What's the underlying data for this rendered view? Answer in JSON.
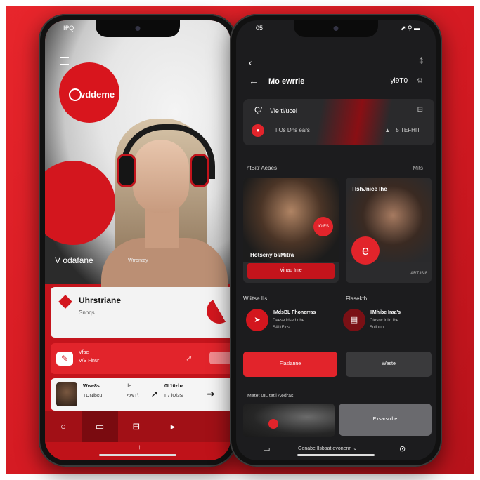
{
  "left_phone": {
    "status": {
      "time": "I₽Q"
    },
    "hero": {
      "brand": "vddeme",
      "caption": "V odafane",
      "sub": "Wrronæy"
    },
    "card": {
      "title": "Uhrstriane",
      "subtitle": "Snnqs"
    },
    "promo": {
      "line1": "Vfae",
      "line2": "V/S Flnur",
      "badge": ""
    },
    "list": {
      "a1": "Wwe8s",
      "a2": "TDNlbsu",
      "b1": "lle",
      "b2": "AWT\\",
      "c1": "0I 10zba",
      "c2": "I 7 lUl3S"
    },
    "tabs": [
      "○",
      "▭",
      "⊟",
      "▸"
    ],
    "bottom": "↑"
  },
  "right_phone": {
    "status": {
      "time": "05",
      "icons": "⬈ ⚲ ▬"
    },
    "top_back": "‹",
    "top_icon": "⁑",
    "header": {
      "title": "Mo ewrrie",
      "count": "yl9T0",
      "settings": "⚙"
    },
    "player": {
      "q": "Ç/",
      "title": "Vie tl/ucel",
      "right": "⊟",
      "line2": "I!Os Dhs ears",
      "line3": "▲  ⠀5 ṮEFHIT"
    },
    "section1": {
      "left": "ThtBitr Aeaes",
      "right": "Mits"
    },
    "tile_a": {
      "label": "Hotseny bI/Mitra",
      "button": "Vinau Ime",
      "pill": "IOIFS"
    },
    "tile_b": {
      "head": "TlshJnice Ihe",
      "logo": "e",
      "tiny": "ARTJSI8"
    },
    "section2": {
      "left": "Wiiitse IIs",
      "right": "Flasekth"
    },
    "ep_a": {
      "t1": "IMdsBL Fhonerras",
      "t2": "Deese ldsed dbe",
      "t3": "SAIltFIcs"
    },
    "ep_b": {
      "t1": "IIMhibe Iraa's",
      "t2": "Ctesnc ir iln lbe",
      "t3": "Sulluun"
    },
    "btn_red": "Flaslanne",
    "btn_dark": "Weste",
    "section3": "Matet 0IL tatll Aedras",
    "btn_gray": "Exsarsolhe",
    "tabbar": {
      "left_icon": "▭",
      "label": "Genabe Ilsbaat evonenn  ⌄",
      "right_icon": "⊙"
    }
  },
  "colors": {
    "background": "#d31a22",
    "accent": "#e2242b",
    "dark_screen": "#1c1c1e"
  }
}
